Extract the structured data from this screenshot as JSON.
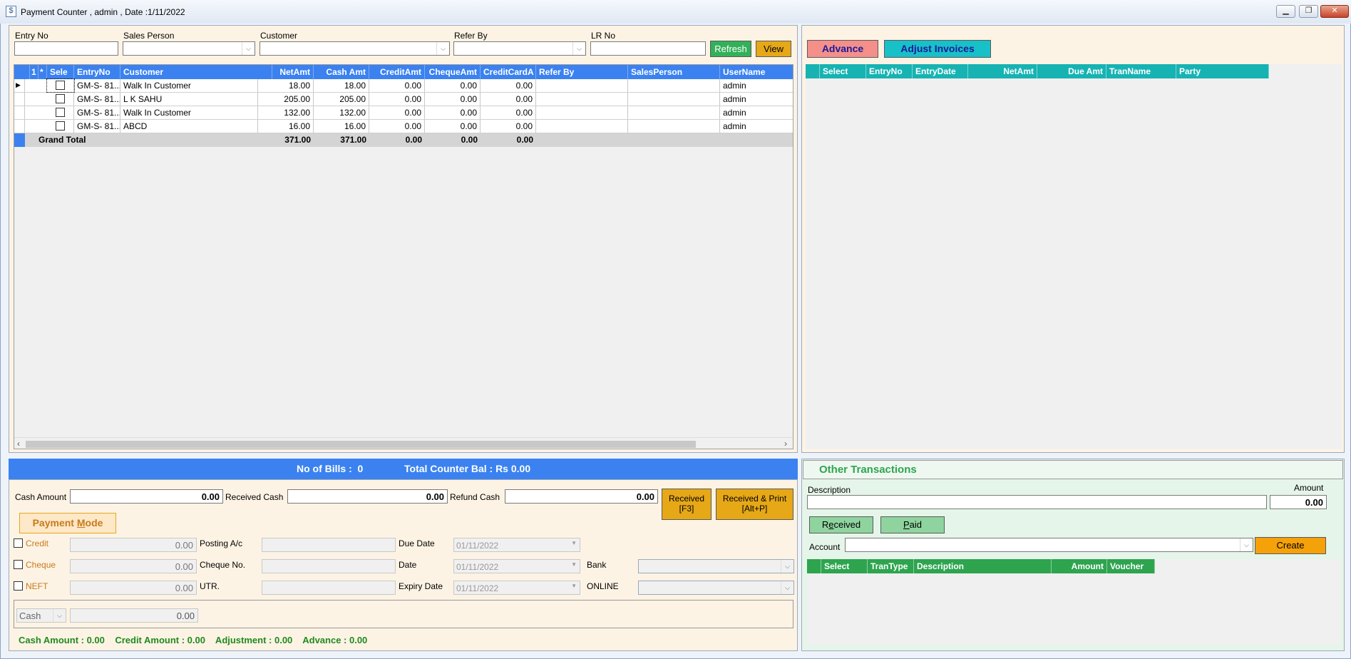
{
  "window": {
    "title": "Payment Counter , admin , Date :1/11/2022",
    "controls": [
      "minimize",
      "restore",
      "close"
    ]
  },
  "filters": {
    "entry_no_label": "Entry No",
    "sales_person_label": "Sales Person",
    "customer_label": "Customer",
    "refer_by_label": "Refer By",
    "lr_no_label": "LR No",
    "refresh_label": "Refresh",
    "view_label": "View"
  },
  "bills_grid": {
    "headers": [
      "1",
      "*",
      "Sele",
      "EntryNo",
      "Customer",
      "NetAmt",
      "Cash Amt",
      "CreditAmt",
      "ChequeAmt",
      "CreditCardA",
      "Refer By",
      "SalesPerson",
      "UserName"
    ],
    "rows": [
      {
        "entry": "GM-S- 81...",
        "customer": "Walk In Customer",
        "net": "18.00",
        "cash": "18.00",
        "credit": "0.00",
        "cheque": "0.00",
        "card": "0.00",
        "refer": "",
        "sales": "",
        "user": "admin"
      },
      {
        "entry": "GM-S- 81...",
        "customer": "L K SAHU",
        "net": "205.00",
        "cash": "205.00",
        "credit": "0.00",
        "cheque": "0.00",
        "card": "0.00",
        "refer": "",
        "sales": "",
        "user": "admin"
      },
      {
        "entry": "GM-S- 81...",
        "customer": "Walk In Customer",
        "net": "132.00",
        "cash": "132.00",
        "credit": "0.00",
        "cheque": "0.00",
        "card": "0.00",
        "refer": "",
        "sales": "",
        "user": "admin"
      },
      {
        "entry": "GM-S- 81...",
        "customer": "ABCD",
        "net": "16.00",
        "cash": "16.00",
        "credit": "0.00",
        "cheque": "0.00",
        "card": "0.00",
        "refer": "",
        "sales": "",
        "user": "admin"
      }
    ],
    "total": {
      "label": "Grand Total",
      "net": "371.00",
      "cash": "371.00",
      "credit": "0.00",
      "cheque": "0.00",
      "card": "0.00"
    }
  },
  "right_top": {
    "advance_label": "Advance",
    "adjust_label": "Adjust Invoices",
    "headers": [
      "Select",
      "EntryNo",
      "EntryDate",
      "NetAmt",
      "Due Amt",
      "TranName",
      "Party"
    ]
  },
  "summary_bar": {
    "bills": "No of Bills :  0",
    "counter_bal": "Total Counter Bal : Rs 0.00"
  },
  "payment": {
    "cash_amount_label": "Cash Amount",
    "cash_amount": "0.00",
    "received_cash_label": "Received Cash",
    "received_cash": "0.00",
    "refund_cash_label": "Refund Cash",
    "refund_cash": "0.00",
    "received_btn": "Received",
    "received_key": "[F3]",
    "received_print_btn": "Received & Print",
    "received_print_key": "[Alt+P]",
    "mode_pre": "Payment ",
    "mode_ul": "M",
    "mode_post": "ode",
    "credit_label": "Credit",
    "credit_value": "0.00",
    "posting_label": "Posting A/c",
    "due_date_label": "Due Date",
    "due_date": "01/11/2022",
    "cheque_label": "Cheque",
    "cheque_value": "0.00",
    "cheque_no_label": "Cheque No.",
    "date_label": "Date",
    "date_value": "01/11/2022",
    "bank_label": "Bank",
    "neft_label": "NEFT",
    "neft_value": "0.00",
    "utr_label": "UTR.",
    "expiry_label": "Expiry Date",
    "expiry_value": "01/11/2022",
    "online_label": "ONLINE",
    "cash_select": "Cash",
    "cash_select_value": "0.00",
    "footer": "Cash Amount : 0.00    Credit Amount : 0.00    Adjustment : 0.00    Advance : 0.00"
  },
  "other": {
    "title": "Other Transactions",
    "description_label": "Description",
    "amount_label": "Amount",
    "amount": "0.00",
    "received_pre": "R",
    "received_ul": "e",
    "received_post": "ceived",
    "paid_ul": "P",
    "paid_post": "aid",
    "account_label": "Account",
    "create_label": "Create",
    "headers": [
      "Select",
      "TranType",
      "Description",
      "Amount",
      "Voucher"
    ]
  },
  "colors": {
    "grid_header": "#3b82f0",
    "panel_bg": "#fdf3e4",
    "advance_btn": "#f58f8a",
    "adjust_btn": "#18c0c8",
    "orange_btn": "#e6a817",
    "green_btn": "#33b05a"
  }
}
